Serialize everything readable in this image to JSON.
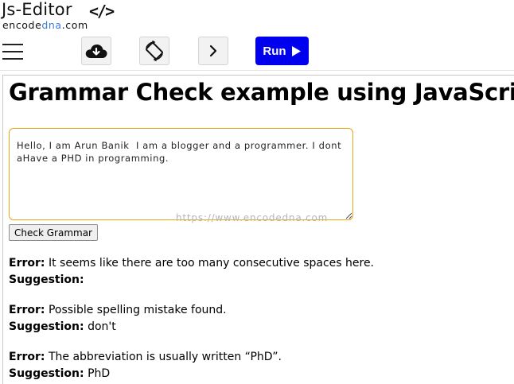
{
  "header": {
    "brand_title": "Js-Editor",
    "brand_code": "</>",
    "brand_site_prefix": "encode",
    "brand_site_accent": "dna",
    "brand_site_suffix": ".com"
  },
  "toolbar": {
    "menu_icon": "hamburger-icon",
    "download_icon": "cloud-download-icon",
    "rotate_icon": "rotate-icon",
    "next_icon": "chevron-right-icon",
    "run_label": "Run",
    "run_color": "#0000ee"
  },
  "page": {
    "title": "Grammar Check example using JavaScript",
    "textarea_value": "Hello, I am Arun Banik  I am a blogger and a programmer. I dont aHave a PHD in programming.",
    "textarea_border_color": "#e6a817",
    "watermark": "https://www.encodedna.com",
    "check_button_label": "Check Grammar",
    "error_label": "Error:",
    "suggestion_label": "Suggestion:",
    "results": [
      {
        "error": "It seems like there are too many consecutive spaces here.",
        "suggestion": ""
      },
      {
        "error": "Possible spelling mistake found.",
        "suggestion": "don't"
      },
      {
        "error": "The abbreviation is usually written “PhD”.",
        "suggestion": "PhD"
      }
    ]
  }
}
